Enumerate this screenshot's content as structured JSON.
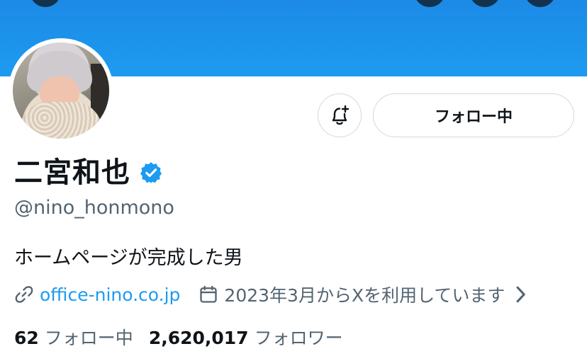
{
  "colors": {
    "banner": "#1d9bf0",
    "accent": "#1d9bf0",
    "secondary_text": "#536471",
    "border": "#cfd9de"
  },
  "header": {
    "banner_buttons": [
      "back-button",
      "search-button",
      "more-button"
    ]
  },
  "profile": {
    "display_name": "二宮和也",
    "verified": true,
    "handle": "@nino_honmono",
    "bio": "ホームページが完成した男",
    "website": "office-nino.co.jp",
    "joined": "2023年3月からXを利用しています"
  },
  "actions": {
    "notify_icon": "bell-plus-icon",
    "follow_label": "フォロー中"
  },
  "stats": {
    "following_count": "62",
    "following_label": "フォロー中",
    "followers_count": "2,620,017",
    "followers_label": "フォロワー"
  }
}
